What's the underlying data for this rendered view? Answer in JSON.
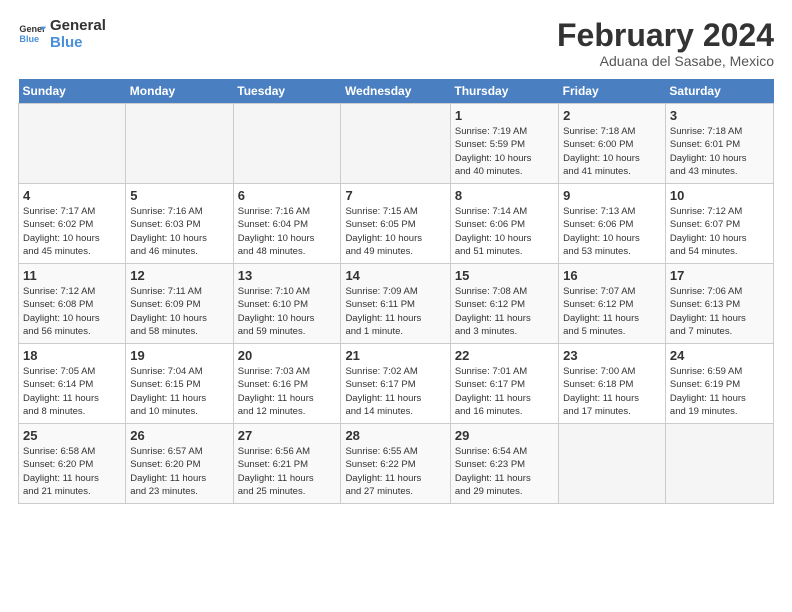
{
  "logo": {
    "line1": "General",
    "line2": "Blue"
  },
  "title": "February 2024",
  "subtitle": "Aduana del Sasabe, Mexico",
  "days_header": [
    "Sunday",
    "Monday",
    "Tuesday",
    "Wednesday",
    "Thursday",
    "Friday",
    "Saturday"
  ],
  "weeks": [
    [
      {
        "num": "",
        "detail": ""
      },
      {
        "num": "",
        "detail": ""
      },
      {
        "num": "",
        "detail": ""
      },
      {
        "num": "",
        "detail": ""
      },
      {
        "num": "1",
        "detail": "Sunrise: 7:19 AM\nSunset: 5:59 PM\nDaylight: 10 hours\nand 40 minutes."
      },
      {
        "num": "2",
        "detail": "Sunrise: 7:18 AM\nSunset: 6:00 PM\nDaylight: 10 hours\nand 41 minutes."
      },
      {
        "num": "3",
        "detail": "Sunrise: 7:18 AM\nSunset: 6:01 PM\nDaylight: 10 hours\nand 43 minutes."
      }
    ],
    [
      {
        "num": "4",
        "detail": "Sunrise: 7:17 AM\nSunset: 6:02 PM\nDaylight: 10 hours\nand 45 minutes."
      },
      {
        "num": "5",
        "detail": "Sunrise: 7:16 AM\nSunset: 6:03 PM\nDaylight: 10 hours\nand 46 minutes."
      },
      {
        "num": "6",
        "detail": "Sunrise: 7:16 AM\nSunset: 6:04 PM\nDaylight: 10 hours\nand 48 minutes."
      },
      {
        "num": "7",
        "detail": "Sunrise: 7:15 AM\nSunset: 6:05 PM\nDaylight: 10 hours\nand 49 minutes."
      },
      {
        "num": "8",
        "detail": "Sunrise: 7:14 AM\nSunset: 6:06 PM\nDaylight: 10 hours\nand 51 minutes."
      },
      {
        "num": "9",
        "detail": "Sunrise: 7:13 AM\nSunset: 6:06 PM\nDaylight: 10 hours\nand 53 minutes."
      },
      {
        "num": "10",
        "detail": "Sunrise: 7:12 AM\nSunset: 6:07 PM\nDaylight: 10 hours\nand 54 minutes."
      }
    ],
    [
      {
        "num": "11",
        "detail": "Sunrise: 7:12 AM\nSunset: 6:08 PM\nDaylight: 10 hours\nand 56 minutes."
      },
      {
        "num": "12",
        "detail": "Sunrise: 7:11 AM\nSunset: 6:09 PM\nDaylight: 10 hours\nand 58 minutes."
      },
      {
        "num": "13",
        "detail": "Sunrise: 7:10 AM\nSunset: 6:10 PM\nDaylight: 10 hours\nand 59 minutes."
      },
      {
        "num": "14",
        "detail": "Sunrise: 7:09 AM\nSunset: 6:11 PM\nDaylight: 11 hours\nand 1 minute."
      },
      {
        "num": "15",
        "detail": "Sunrise: 7:08 AM\nSunset: 6:12 PM\nDaylight: 11 hours\nand 3 minutes."
      },
      {
        "num": "16",
        "detail": "Sunrise: 7:07 AM\nSunset: 6:12 PM\nDaylight: 11 hours\nand 5 minutes."
      },
      {
        "num": "17",
        "detail": "Sunrise: 7:06 AM\nSunset: 6:13 PM\nDaylight: 11 hours\nand 7 minutes."
      }
    ],
    [
      {
        "num": "18",
        "detail": "Sunrise: 7:05 AM\nSunset: 6:14 PM\nDaylight: 11 hours\nand 8 minutes."
      },
      {
        "num": "19",
        "detail": "Sunrise: 7:04 AM\nSunset: 6:15 PM\nDaylight: 11 hours\nand 10 minutes."
      },
      {
        "num": "20",
        "detail": "Sunrise: 7:03 AM\nSunset: 6:16 PM\nDaylight: 11 hours\nand 12 minutes."
      },
      {
        "num": "21",
        "detail": "Sunrise: 7:02 AM\nSunset: 6:17 PM\nDaylight: 11 hours\nand 14 minutes."
      },
      {
        "num": "22",
        "detail": "Sunrise: 7:01 AM\nSunset: 6:17 PM\nDaylight: 11 hours\nand 16 minutes."
      },
      {
        "num": "23",
        "detail": "Sunrise: 7:00 AM\nSunset: 6:18 PM\nDaylight: 11 hours\nand 17 minutes."
      },
      {
        "num": "24",
        "detail": "Sunrise: 6:59 AM\nSunset: 6:19 PM\nDaylight: 11 hours\nand 19 minutes."
      }
    ],
    [
      {
        "num": "25",
        "detail": "Sunrise: 6:58 AM\nSunset: 6:20 PM\nDaylight: 11 hours\nand 21 minutes."
      },
      {
        "num": "26",
        "detail": "Sunrise: 6:57 AM\nSunset: 6:20 PM\nDaylight: 11 hours\nand 23 minutes."
      },
      {
        "num": "27",
        "detail": "Sunrise: 6:56 AM\nSunset: 6:21 PM\nDaylight: 11 hours\nand 25 minutes."
      },
      {
        "num": "28",
        "detail": "Sunrise: 6:55 AM\nSunset: 6:22 PM\nDaylight: 11 hours\nand 27 minutes."
      },
      {
        "num": "29",
        "detail": "Sunrise: 6:54 AM\nSunset: 6:23 PM\nDaylight: 11 hours\nand 29 minutes."
      },
      {
        "num": "",
        "detail": ""
      },
      {
        "num": "",
        "detail": ""
      }
    ]
  ]
}
